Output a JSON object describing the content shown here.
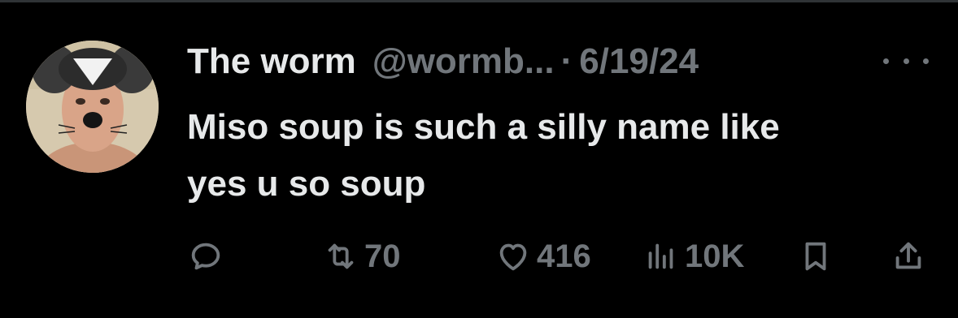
{
  "tweet": {
    "author_name": "The worm",
    "author_handle": "@wormb...",
    "separator": "·",
    "date": "6/19/24",
    "text_line1": "Miso soup is such a silly name like",
    "text_line2": "yes u so soup"
  },
  "actions": {
    "reply_icon": "reply-icon",
    "retweet_icon": "retweet-icon",
    "retweet_count": "70",
    "like_icon": "heart-icon",
    "like_count": "416",
    "views_icon": "views-chart-icon",
    "views_count": "10K",
    "bookmark_icon": "bookmark-icon",
    "share_icon": "share-icon"
  },
  "colors": {
    "background": "#000000",
    "primary_text": "#e7e9ea",
    "secondary_text": "#71767b",
    "divider": "#2f3336"
  }
}
